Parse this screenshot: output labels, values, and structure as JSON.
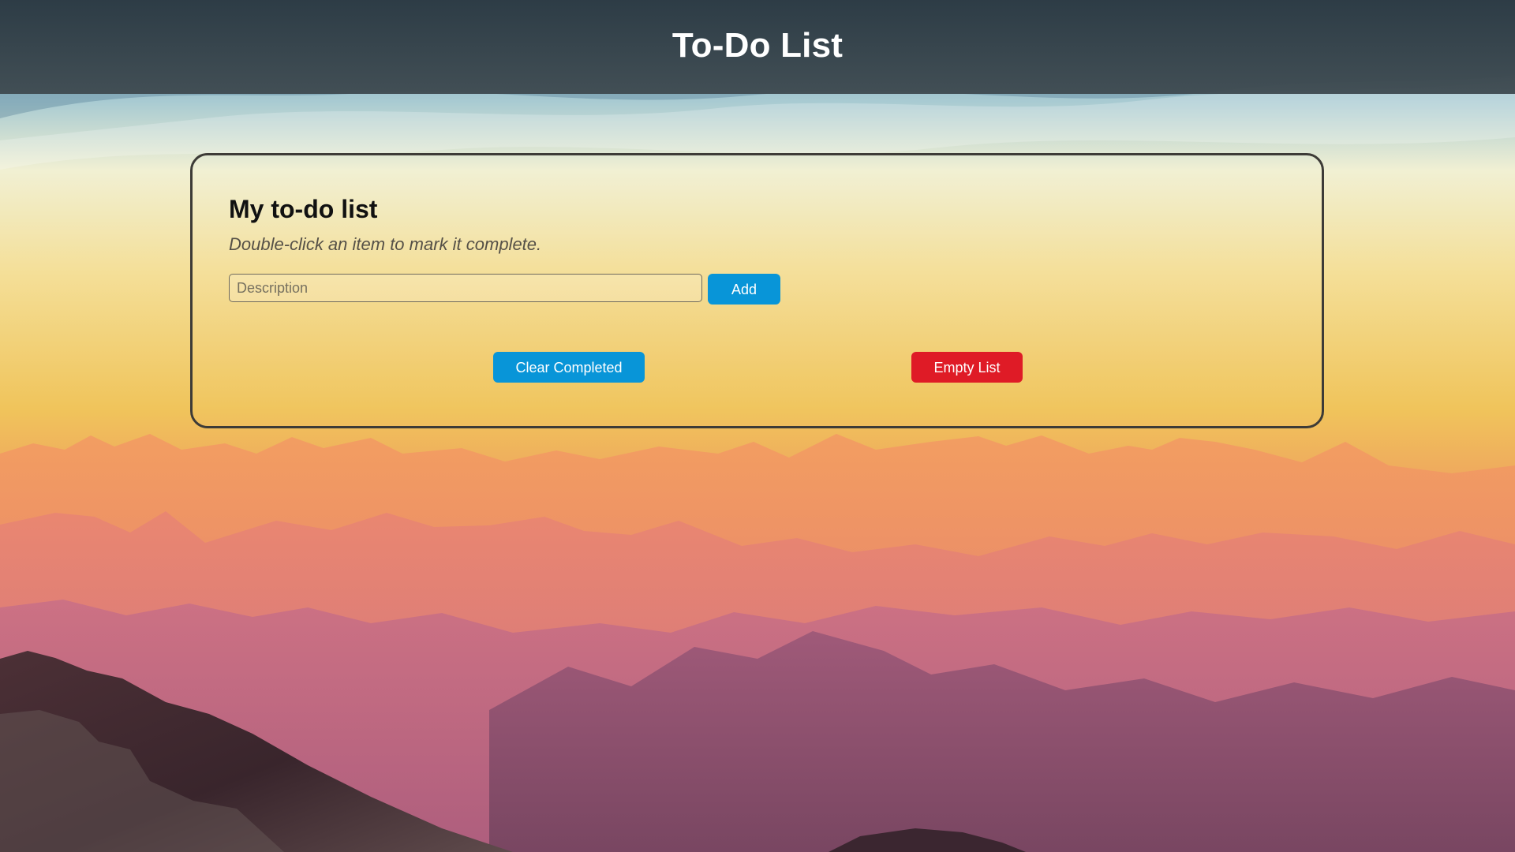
{
  "app": {
    "title": "To-Do List"
  },
  "todo": {
    "heading": "My to-do list",
    "instructions": "Double-click an item to mark it complete.",
    "input": {
      "value": "",
      "placeholder": "Description"
    },
    "buttons": {
      "add": "Add",
      "clear_completed": "Clear Completed",
      "empty_list": "Empty List"
    }
  },
  "colors": {
    "header": "#3f4b51",
    "panel_border": "#3d3b37",
    "primary_button": "#0895d8",
    "danger_button": "#df1b26"
  },
  "background": {
    "scene": "mountain-sunset-image"
  }
}
